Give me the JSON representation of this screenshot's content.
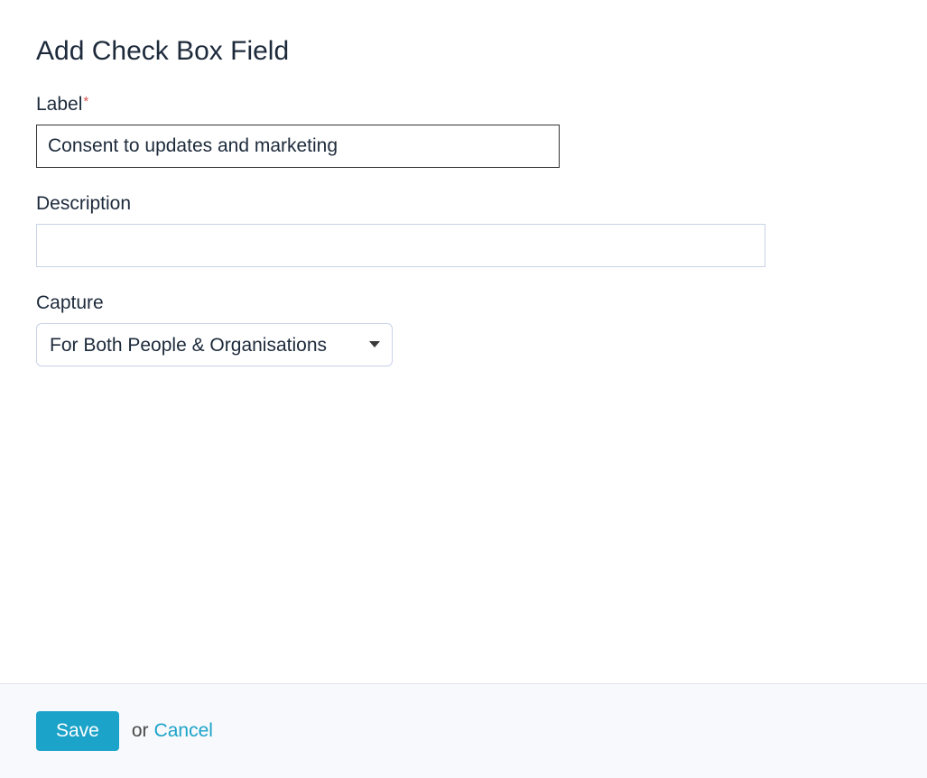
{
  "header": {
    "title": "Add Check Box Field"
  },
  "form": {
    "label": {
      "text": "Label",
      "required_marker": "*",
      "value": "Consent to updates and marketing"
    },
    "description": {
      "text": "Description",
      "value": ""
    },
    "capture": {
      "text": "Capture",
      "selected": "For Both People & Organisations"
    }
  },
  "footer": {
    "save_label": "Save",
    "or_text": "or",
    "cancel_label": "Cancel"
  }
}
